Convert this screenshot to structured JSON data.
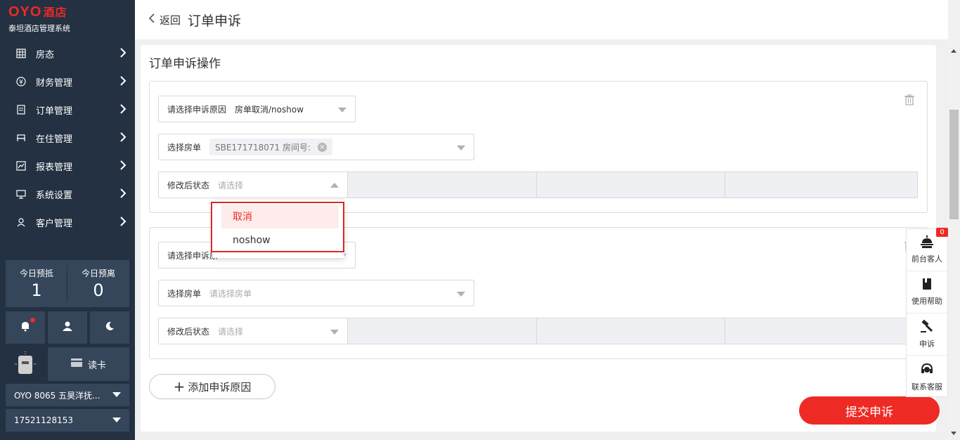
{
  "brand": {
    "logo": "OYO",
    "logo_cn": "酒店",
    "subtitle": "泰坦酒店管理系统"
  },
  "sidebar": {
    "menu": [
      {
        "label": "房态",
        "icon": "grid-icon"
      },
      {
        "label": "财务管理",
        "icon": "yen-icon"
      },
      {
        "label": "订单管理",
        "icon": "document-icon"
      },
      {
        "label": "在住管理",
        "icon": "bed-icon"
      },
      {
        "label": "报表管理",
        "icon": "chart-icon"
      },
      {
        "label": "系统设置",
        "icon": "monitor-icon"
      },
      {
        "label": "客户管理",
        "icon": "person-icon"
      }
    ],
    "stats": [
      {
        "label": "今日预抵",
        "value": "1"
      },
      {
        "label": "今日预离",
        "value": "0"
      }
    ],
    "reader_label": "读卡",
    "hotel_select": "OYO 8065 五昊洋抚...",
    "phone_select": "17521128153"
  },
  "header": {
    "back_label": "返回",
    "title": "订单申诉"
  },
  "panel": {
    "title": "订单申诉操作",
    "card1": {
      "reason_label": "请选择申诉原因",
      "reason_value": "房单取消/noshow",
      "order_label": "选择房单",
      "order_tag": "SBE171718071 房间号:",
      "status_label": "修改后状态",
      "status_placeholder": "请选择"
    },
    "card2": {
      "reason_label": "请选择申诉原",
      "reason_value": "",
      "order_label": "选择房单",
      "order_placeholder": "请选择房单",
      "status_label": "修改后状态",
      "status_placeholder": "请选择"
    },
    "add_label": "添加申诉原因",
    "submit_label": "提交申诉"
  },
  "dropdown": {
    "options": [
      "取消",
      "noshow"
    ],
    "highlighted": "取消"
  },
  "float_bar": {
    "badge": "0",
    "items": [
      {
        "label": "前台客人",
        "icon": "bell-desk-icon"
      },
      {
        "label": "使用帮助",
        "icon": "book-icon"
      },
      {
        "label": "申诉",
        "icon": "gavel-icon"
      },
      {
        "label": "联系客服",
        "icon": "headset-icon"
      }
    ]
  },
  "colors": {
    "accent": "#ee2a24",
    "sidebar_bg": "#233142",
    "sidebar_panel": "#35455a"
  }
}
